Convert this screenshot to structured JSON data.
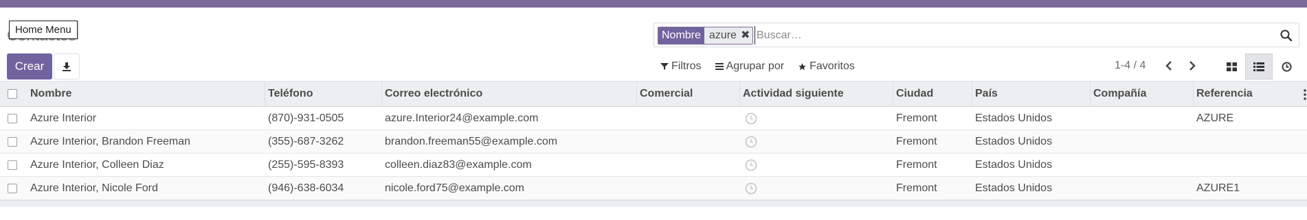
{
  "app": {
    "home_menu_tooltip": "Home Menu",
    "breadcrumb": "Contactos"
  },
  "actions": {
    "create_label": "Crear",
    "download_icon": "download-icon"
  },
  "search": {
    "facet_label": "Nombre",
    "facet_value": "azure",
    "placeholder": "Buscar…",
    "search_icon": "search-icon"
  },
  "filters": {
    "filters_label": "Filtros",
    "group_by_label": "Agrupar por",
    "favorites_label": "Favoritos"
  },
  "pager": {
    "value": "1-4 / 4"
  },
  "views": [
    "kanban-view-icon",
    "list-view-icon",
    "activity-view-icon"
  ],
  "table": {
    "columns": [
      "Nombre",
      "Teléfono",
      "Correo electrónico",
      "Comercial",
      "Actividad siguiente",
      "Ciudad",
      "País",
      "Compañía",
      "Referencia"
    ],
    "rows": [
      {
        "nombre": "Azure Interior",
        "telefono": "(870)-931-0505",
        "correo": "azure.Interior24@example.com",
        "comercial": "",
        "ciudad": "Fremont",
        "pais": "Estados Unidos",
        "compania": "",
        "referencia": "AZURE"
      },
      {
        "nombre": "Azure Interior, Brandon Freeman",
        "telefono": "(355)-687-3262",
        "correo": "brandon.freeman55@example.com",
        "comercial": "",
        "ciudad": "Fremont",
        "pais": "Estados Unidos",
        "compania": "",
        "referencia": ""
      },
      {
        "nombre": "Azure Interior, Colleen Diaz",
        "telefono": "(255)-595-8393",
        "correo": "colleen.diaz83@example.com",
        "comercial": "",
        "ciudad": "Fremont",
        "pais": "Estados Unidos",
        "compania": "",
        "referencia": ""
      },
      {
        "nombre": "Azure Interior, Nicole Ford",
        "telefono": "(946)-638-6034",
        "correo": "nicole.ford75@example.com",
        "comercial": "",
        "ciudad": "Fremont",
        "pais": "Estados Unidos",
        "compania": "",
        "referencia": "AZURE1"
      }
    ]
  },
  "colors": {
    "topbar": "#7c6b9a",
    "primary": "#71639e"
  }
}
